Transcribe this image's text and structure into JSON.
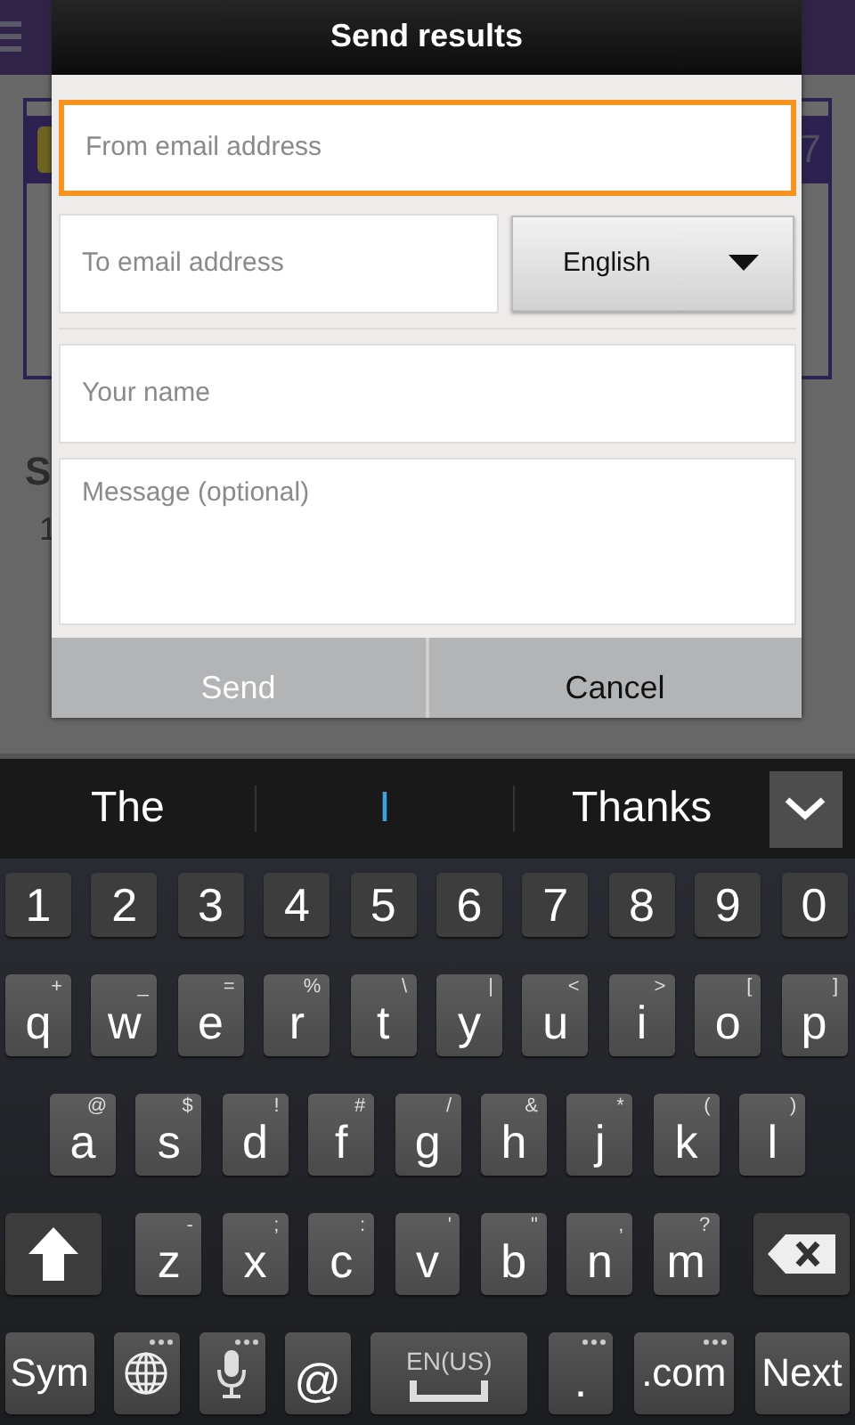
{
  "background_page": {
    "card_number": "7",
    "section_heading": "S",
    "list_numbers": [
      "1"
    ]
  },
  "dialog": {
    "title": "Send results",
    "from_field": {
      "placeholder": "From email address",
      "focused": true
    },
    "to_field": {
      "placeholder": "To email address",
      "focused": false
    },
    "language_select": {
      "value": "English"
    },
    "name_field": {
      "placeholder": "Your name",
      "focused": false
    },
    "message_field": {
      "placeholder": "Message (optional)",
      "focused": false
    },
    "buttons": [
      {
        "label": "Send",
        "disabled": true
      },
      {
        "label": "Cancel",
        "disabled": false
      }
    ]
  },
  "keyboard": {
    "suggestions": [
      {
        "text": "The",
        "selected": false
      },
      {
        "text": "I",
        "selected": true
      },
      {
        "text": "Thanks",
        "selected": false
      }
    ],
    "rows": [
      [
        {
          "kind": "char",
          "label": "1"
        },
        {
          "kind": "char",
          "label": "2"
        },
        {
          "kind": "char",
          "label": "3"
        },
        {
          "kind": "char",
          "label": "4"
        },
        {
          "kind": "char",
          "label": "5"
        },
        {
          "kind": "char",
          "label": "6"
        },
        {
          "kind": "char",
          "label": "7"
        },
        {
          "kind": "char",
          "label": "8"
        },
        {
          "kind": "char",
          "label": "9"
        },
        {
          "kind": "char",
          "label": "0"
        }
      ],
      [
        {
          "kind": "char",
          "label": "q",
          "alt": "+"
        },
        {
          "kind": "char",
          "label": "w",
          "alt": "_"
        },
        {
          "kind": "char",
          "label": "e",
          "alt": "="
        },
        {
          "kind": "char",
          "label": "r",
          "alt": "%"
        },
        {
          "kind": "char",
          "label": "t",
          "alt": "\\"
        },
        {
          "kind": "char",
          "label": "y",
          "alt": "|"
        },
        {
          "kind": "char",
          "label": "u",
          "alt": "<"
        },
        {
          "kind": "char",
          "label": "i",
          "alt": ">"
        },
        {
          "kind": "char",
          "label": "o",
          "alt": "["
        },
        {
          "kind": "char",
          "label": "p",
          "alt": "]"
        }
      ],
      [
        {
          "kind": "char",
          "label": "a",
          "alt": "@"
        },
        {
          "kind": "char",
          "label": "s",
          "alt": "$"
        },
        {
          "kind": "char",
          "label": "d",
          "alt": "!"
        },
        {
          "kind": "char",
          "label": "f",
          "alt": "#"
        },
        {
          "kind": "char",
          "label": "g",
          "alt": "/"
        },
        {
          "kind": "char",
          "label": "h",
          "alt": "&"
        },
        {
          "kind": "char",
          "label": "j",
          "alt": "*"
        },
        {
          "kind": "char",
          "label": "k",
          "alt": "("
        },
        {
          "kind": "char",
          "label": "l",
          "alt": ")"
        }
      ],
      [
        {
          "kind": "shift"
        },
        {
          "kind": "char",
          "label": "z",
          "alt": "-"
        },
        {
          "kind": "char",
          "label": "x",
          "alt": ";"
        },
        {
          "kind": "char",
          "label": "c",
          "alt": ":"
        },
        {
          "kind": "char",
          "label": "v",
          "alt": "'"
        },
        {
          "kind": "char",
          "label": "b",
          "alt": "\""
        },
        {
          "kind": "char",
          "label": "n",
          "alt": ","
        },
        {
          "kind": "char",
          "label": "m",
          "alt": "?"
        },
        {
          "kind": "backspace"
        }
      ]
    ],
    "function_row": [
      {
        "kind": "word",
        "label": "Sym",
        "more": false
      },
      {
        "kind": "globe",
        "more": true
      },
      {
        "kind": "mic",
        "more": true
      },
      {
        "kind": "char",
        "label": "@",
        "more": false
      },
      {
        "kind": "space",
        "label": "EN(US)",
        "more": false
      },
      {
        "kind": "char",
        "label": ".",
        "more": true
      },
      {
        "kind": "word",
        "label": ".com",
        "more": true
      },
      {
        "kind": "word",
        "label": "Next",
        "more": false
      }
    ]
  }
}
